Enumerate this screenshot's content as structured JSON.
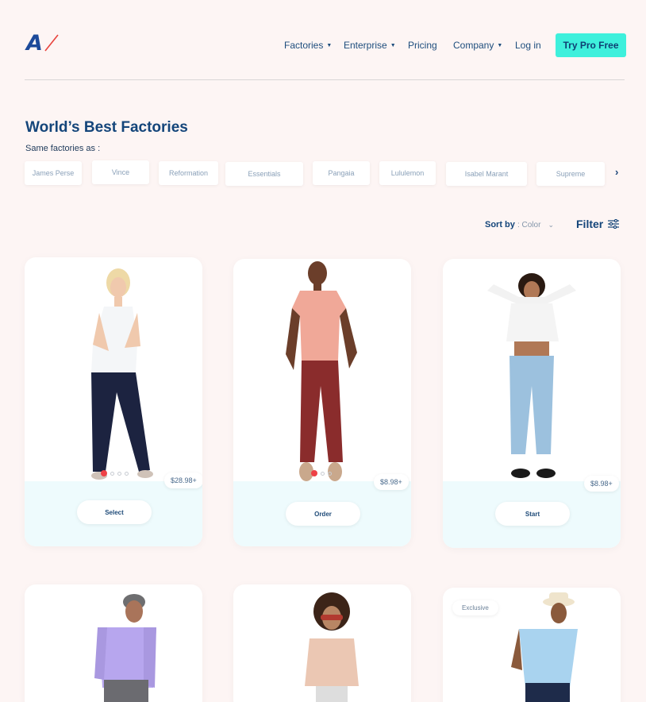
{
  "header": {
    "logo_text": "A",
    "nav": [
      {
        "label": "Factories",
        "caret": true
      },
      {
        "label": "Enterprise",
        "caret": true
      },
      {
        "label": "Pricing",
        "caret": false
      },
      {
        "label": "Company",
        "caret": true
      },
      {
        "label": "Log in",
        "caret": false
      }
    ],
    "cta": "Try Pro Free"
  },
  "main": {
    "title": "World’s Best Factories",
    "subtitle": "Same factories as :",
    "brands": [
      "James Perse",
      "Vince",
      "Reformation",
      "Essentials",
      "Pangaia",
      "Lululemon",
      "Isabel Marant",
      "Supreme"
    ],
    "sort_label": "Sort by",
    "sort_value": ": Color",
    "filter_label": "Filter"
  },
  "products": [
    {
      "price": "$28.98+",
      "action": "Select"
    },
    {
      "price": "$8.98+",
      "action": "Order"
    },
    {
      "price": "$8.98+",
      "action": "Start"
    },
    {
      "badge": ""
    },
    {
      "badge": ""
    },
    {
      "badge": "Exclusive"
    }
  ],
  "colors": {
    "background": "#fdf5f4",
    "cta": "#3ef0dc",
    "brand_blue": "#14457a",
    "card_bottom": "#eefbfd",
    "active_dot": "#ee4146"
  }
}
